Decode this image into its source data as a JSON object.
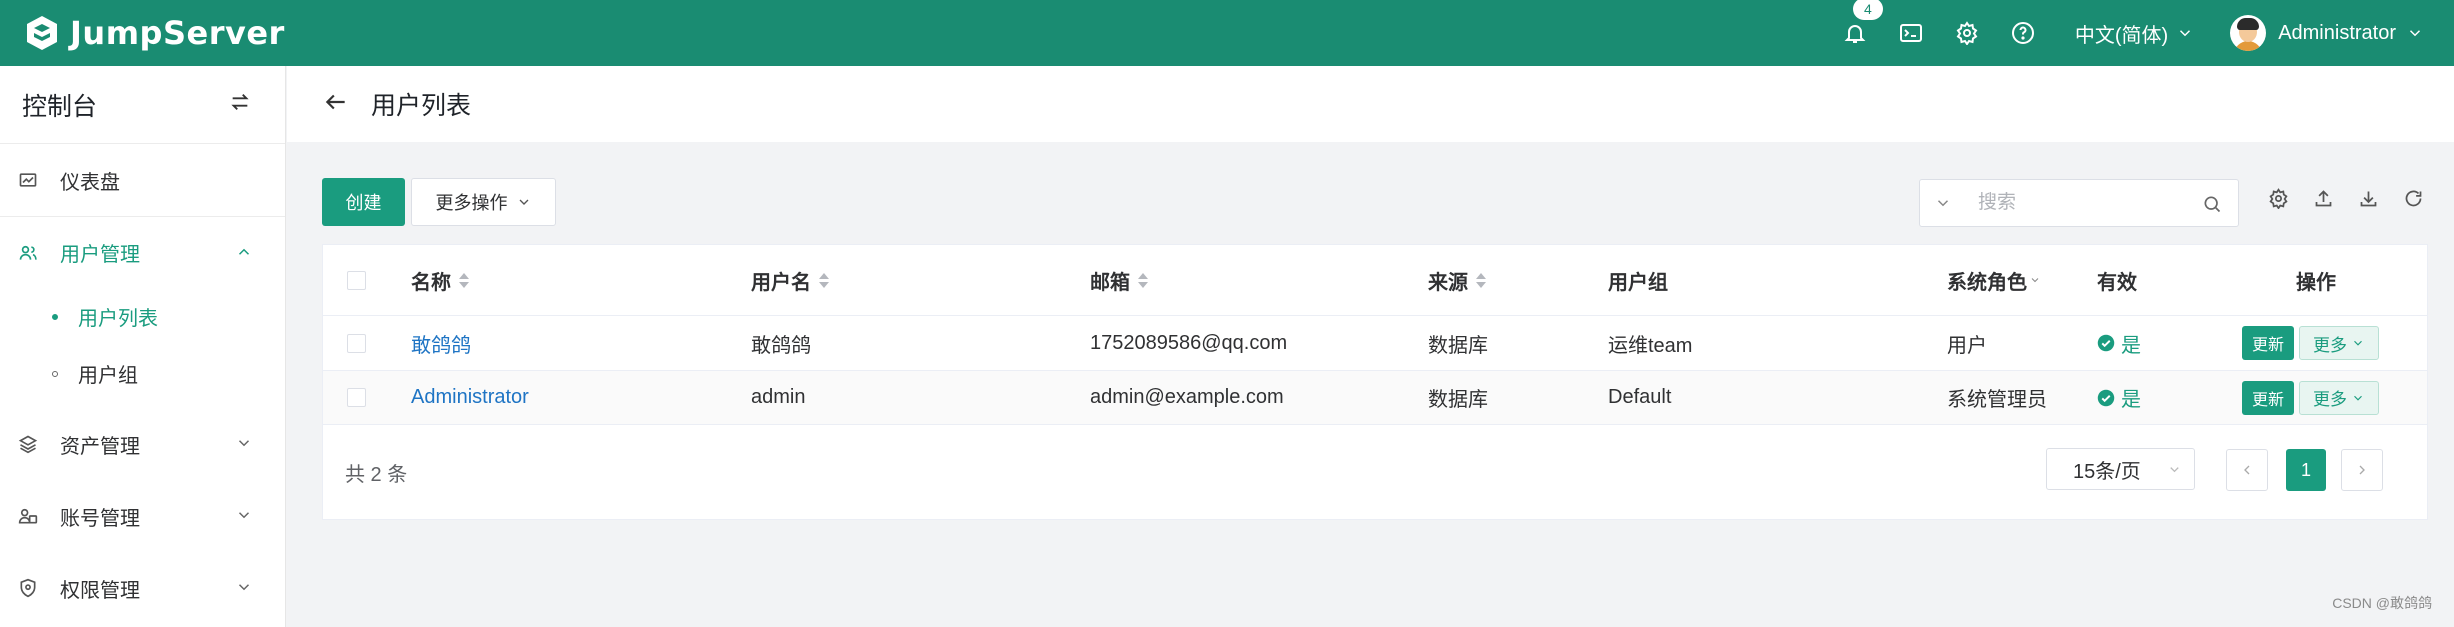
{
  "app": {
    "name": "JumpServer",
    "brand_color": "#1a8c72",
    "accent_color": "#1a9c7f",
    "link_color": "#1e74c4"
  },
  "topbar": {
    "notification_count": "4",
    "icons": [
      "bell-icon",
      "terminal-icon",
      "gear-icon",
      "help-icon"
    ],
    "language": "中文(简体)",
    "user_name": "Administrator"
  },
  "sidebar": {
    "title": "控制台",
    "items": [
      {
        "label": "仪表盘",
        "icon": "dashboard-icon"
      },
      {
        "label": "用户管理",
        "icon": "users-icon",
        "expanded": true
      },
      {
        "label": "资产管理",
        "icon": "layers-icon"
      },
      {
        "label": "账号管理",
        "icon": "account-icon"
      },
      {
        "label": "权限管理",
        "icon": "shield-icon"
      }
    ],
    "sub_items": [
      {
        "label": "用户列表",
        "active": true
      },
      {
        "label": "用户组",
        "active": false
      }
    ]
  },
  "page": {
    "title": "用户列表"
  },
  "toolbar": {
    "create_label": "创建",
    "more_actions_label": "更多操作",
    "search_placeholder": "搜索"
  },
  "table": {
    "columns": [
      "名称",
      "用户名",
      "邮箱",
      "来源",
      "用户组",
      "系统角色",
      "有效",
      "操作"
    ],
    "rows": [
      {
        "name": "敢鸽鸽",
        "username": "敢鸽鸽",
        "email": "1752089586@qq.com",
        "source": "数据库",
        "group": "运维team",
        "role": "用户",
        "valid": "是"
      },
      {
        "name": "Administrator",
        "username": "admin",
        "email": "admin@example.com",
        "source": "数据库",
        "group": "Default",
        "role": "系统管理员",
        "valid": "是"
      }
    ],
    "update_label": "更新",
    "more_label": "更多"
  },
  "pagination": {
    "total": "共 2 条",
    "page_size": "15条/页",
    "current_page": "1"
  },
  "watermark": "CSDN @敢鸽鸽"
}
